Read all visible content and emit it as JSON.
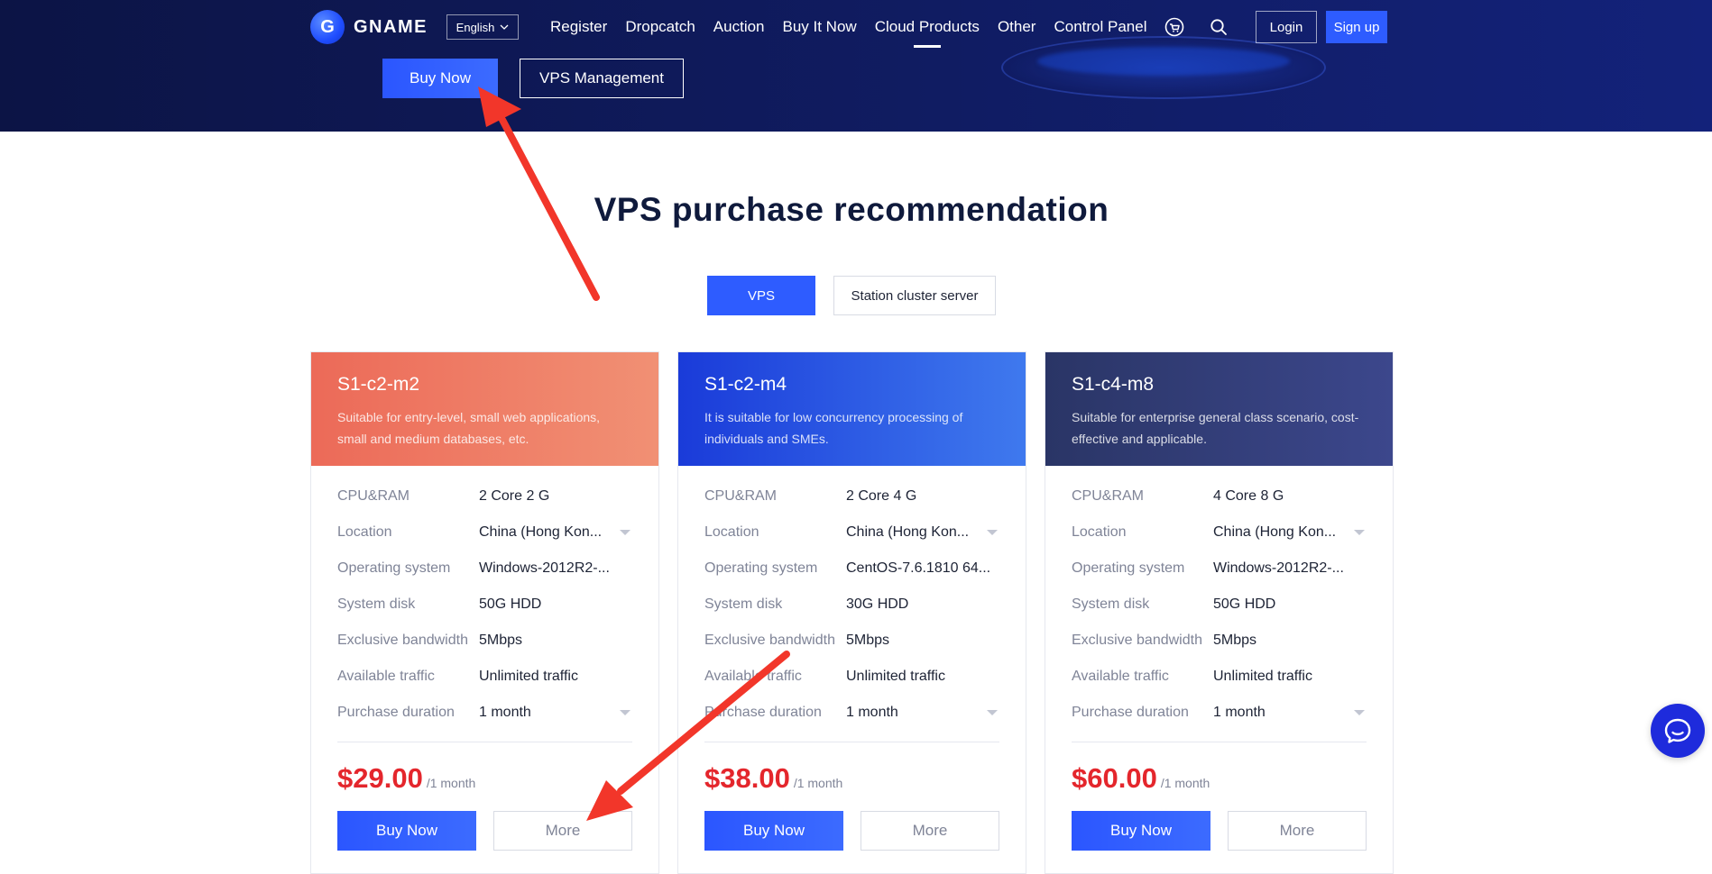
{
  "nav": {
    "logo_text": "GNAME",
    "logo_glyph": "G",
    "language": "English",
    "items": [
      {
        "label": "Register",
        "active": false
      },
      {
        "label": "Dropcatch",
        "active": false
      },
      {
        "label": "Auction",
        "active": false
      },
      {
        "label": "Buy It Now",
        "active": false
      },
      {
        "label": "Cloud Products",
        "active": true
      },
      {
        "label": "Other",
        "active": false
      },
      {
        "label": "Control Panel",
        "active": false
      }
    ],
    "login": "Login",
    "signup": "Sign up"
  },
  "hero": {
    "buy_now": "Buy Now",
    "vps_management": "VPS Management"
  },
  "section": {
    "title": "VPS purchase recommendation",
    "tabs": [
      "VPS",
      "Station cluster server"
    ]
  },
  "cards": [
    {
      "name": "S1-c2-m2",
      "desc": "Suitable for entry-level, small web applications, small and medium databases, etc.",
      "color": "#ec6a58",
      "specs": [
        {
          "label": "CPU&RAM",
          "value": "2 Core 2 G",
          "dropdown": false
        },
        {
          "label": "Location",
          "value": "China (Hong Kon...",
          "dropdown": true
        },
        {
          "label": "Operating system",
          "value": "Windows-2012R2-...",
          "dropdown": false
        },
        {
          "label": "System disk",
          "value": "50G HDD",
          "dropdown": false
        },
        {
          "label": "Exclusive bandwidth",
          "value": "5Mbps",
          "dropdown": false
        },
        {
          "label": "Available traffic",
          "value": "Unlimited traffic",
          "dropdown": false
        },
        {
          "label": "Purchase duration",
          "value": "1 month",
          "dropdown": true
        }
      ],
      "price": "$29.00",
      "per": "/1 month",
      "buy": "Buy Now",
      "more": "More"
    },
    {
      "name": "S1-c2-m4",
      "desc": "It is suitable for low concurrency processing of individuals and SMEs.",
      "color": "#1a3bd9",
      "specs": [
        {
          "label": "CPU&RAM",
          "value": "2 Core 4 G",
          "dropdown": false
        },
        {
          "label": "Location",
          "value": "China (Hong Kon...",
          "dropdown": true
        },
        {
          "label": "Operating system",
          "value": "CentOS-7.6.1810 64...",
          "dropdown": false
        },
        {
          "label": "System disk",
          "value": "30G HDD",
          "dropdown": false
        },
        {
          "label": "Exclusive bandwidth",
          "value": "5Mbps",
          "dropdown": false
        },
        {
          "label": "Available traffic",
          "value": "Unlimited traffic",
          "dropdown": false
        },
        {
          "label": "Purchase duration",
          "value": "1 month",
          "dropdown": true
        }
      ],
      "price": "$38.00",
      "per": "/1 month",
      "buy": "Buy Now",
      "more": "More"
    },
    {
      "name": "S1-c4-m8",
      "desc": "Suitable for enterprise general class scenario, cost-effective and applicable.",
      "color": "#2a3566",
      "specs": [
        {
          "label": "CPU&RAM",
          "value": "4 Core 8 G",
          "dropdown": false
        },
        {
          "label": "Location",
          "value": "China (Hong Kon...",
          "dropdown": true
        },
        {
          "label": "Operating system",
          "value": "Windows-2012R2-...",
          "dropdown": false
        },
        {
          "label": "System disk",
          "value": "50G HDD",
          "dropdown": false
        },
        {
          "label": "Exclusive bandwidth",
          "value": "5Mbps",
          "dropdown": false
        },
        {
          "label": "Available traffic",
          "value": "Unlimited traffic",
          "dropdown": false
        },
        {
          "label": "Purchase duration",
          "value": "1 month",
          "dropdown": true
        }
      ],
      "price": "$60.00",
      "per": "/1 month",
      "buy": "Buy Now",
      "more": "More"
    }
  ],
  "icons": {
    "cart": "cart-icon",
    "search": "search-icon",
    "chat": "chat-icon",
    "caret": "caret-down-icon"
  },
  "colors": {
    "primary": "#2e5cff",
    "price": "#e4262c",
    "arrow": "#f2362a"
  }
}
